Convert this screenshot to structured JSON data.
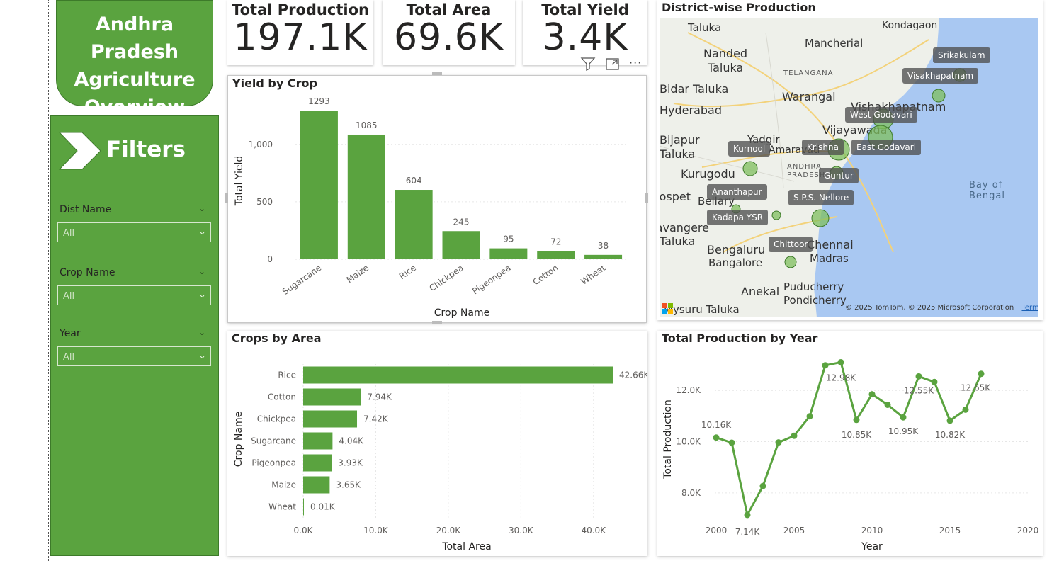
{
  "header": {
    "title": "Andhra Pradesh Agriculture Overview",
    "title_lines": [
      "Andhra Pradesh",
      "Agriculture",
      "Overview"
    ]
  },
  "filters": {
    "title": "Filters",
    "slicers": [
      {
        "label": "Dist Name",
        "value": "All"
      },
      {
        "label": "Crop Name",
        "value": "All"
      },
      {
        "label": "Year",
        "value": "All"
      }
    ]
  },
  "kpis": [
    {
      "label": "Total Production",
      "value": "197.1K"
    },
    {
      "label": "Total Area",
      "value": "69.6K"
    },
    {
      "label": "Total Yield",
      "value": "3.4K"
    }
  ],
  "visual_header_icons": [
    "filter-icon",
    "focus-mode-icon",
    "more-options-icon"
  ],
  "colors": {
    "accent": "#5aa33f",
    "bar": "#5aa33f",
    "sea": "#a9c8f2",
    "land": "#eef0ea"
  },
  "map": {
    "title": "District-wise Production",
    "place_labels": [
      "Taluka",
      "Kondagaon",
      "Mancherial",
      "Nanded",
      "Taluka",
      "Srikakulam",
      "TELANGANA",
      "Bidar Taluka",
      "Warangal",
      "Visakhapatnam",
      "Hyderabad",
      "Vishakhapatnam",
      "Yadgir",
      "Vijayawada",
      "Bijapur",
      "Taluka",
      "Amaravati",
      "ANDHRA",
      "PRADESH",
      "Kurugodu",
      "Bay of Bengal",
      "Bellary",
      "Hospet",
      "Davangere",
      "Taluka",
      "Bengaluru",
      "Bangalore",
      "Chennai",
      "Madras",
      "Anekal",
      "Puducherry",
      "Pondicherry",
      "Mysuru Taluka"
    ],
    "districts": [
      "Srikakulam",
      "Visakhapatnam",
      "West Godavari",
      "Kurnool",
      "Krishna",
      "East Godavari",
      "Guntur",
      "Ananthapur",
      "S.P.S. Nellore",
      "Kadapa YSR",
      "Chittoor"
    ],
    "attribution": "© 2025 TomTom, © 2025 Microsoft Corporation",
    "terms": "Terms",
    "logo": "Microsoft"
  },
  "charts": {
    "yield_by_crop": {
      "title": "Yield by Crop",
      "x_label": "Crop Name",
      "y_label": "Total Yield",
      "y_ticks": [
        "0",
        "500",
        "1,000"
      ],
      "categories": [
        "Sugarcane",
        "Maize",
        "Rice",
        "Chickpea",
        "Pigeonpea",
        "Cotton",
        "Wheat"
      ],
      "values": [
        1293,
        1085,
        604,
        245,
        95,
        72,
        38
      ],
      "data_labels": [
        "1293",
        "1085",
        "604",
        "245",
        "95",
        "72",
        "38"
      ]
    },
    "crops_by_area": {
      "title": "Crops by Area",
      "x_label": "Total Area",
      "y_label": "Crop Name",
      "x_ticks": [
        "0.0K",
        "10.0K",
        "20.0K",
        "30.0K",
        "40.0K"
      ],
      "categories": [
        "Rice",
        "Cotton",
        "Chickpea",
        "Sugarcane",
        "Pigeonpea",
        "Maize",
        "Wheat"
      ],
      "values": [
        42.66,
        7.94,
        7.42,
        4.04,
        3.93,
        3.65,
        0.01
      ],
      "data_labels": [
        "42.66K",
        "7.94K",
        "7.42K",
        "4.04K",
        "3.93K",
        "3.65K",
        "0.01K"
      ]
    },
    "production_by_year": {
      "title": "Total Production by Year",
      "x_label": "Year",
      "y_label": "Total Production",
      "x_ticks": [
        "2000",
        "2005",
        "2010",
        "2015",
        "2020"
      ],
      "y_ticks": [
        "8.0K",
        "10.0K",
        "12.0K"
      ],
      "point_labels": [
        "10.16K",
        "7.14K",
        "12.98K",
        "10.85K",
        "12.55K",
        "10.95K",
        "10.82K",
        "12.65K"
      ]
    }
  },
  "chart_data": [
    {
      "type": "bar",
      "title": "Yield by Crop",
      "xlabel": "Crop Name",
      "ylabel": "Total Yield",
      "categories": [
        "Sugarcane",
        "Maize",
        "Rice",
        "Chickpea",
        "Pigeonpea",
        "Cotton",
        "Wheat"
      ],
      "values": [
        1293,
        1085,
        604,
        245,
        95,
        72,
        38
      ],
      "ylim": [
        0,
        1350
      ]
    },
    {
      "type": "bar",
      "orientation": "horizontal",
      "title": "Crops by Area",
      "xlabel": "Total Area",
      "ylabel": "Crop Name",
      "categories": [
        "Rice",
        "Cotton",
        "Chickpea",
        "Sugarcane",
        "Pigeonpea",
        "Maize",
        "Wheat"
      ],
      "values": [
        42660,
        7940,
        7420,
        4040,
        3930,
        3650,
        10
      ],
      "xlim": [
        0,
        45000
      ]
    },
    {
      "type": "line",
      "title": "Total Production by Year",
      "xlabel": "Year",
      "ylabel": "Total Production",
      "x": [
        2000,
        2001,
        2002,
        2003,
        2004,
        2005,
        2006,
        2007,
        2008,
        2009,
        2010,
        2011,
        2012,
        2013,
        2014,
        2015,
        2016,
        2017
      ],
      "y": [
        10160,
        9960,
        7140,
        8270,
        9970,
        10230,
        10990,
        12980,
        13100,
        10850,
        11850,
        11440,
        10950,
        12550,
        12330,
        10820,
        11250,
        12650
      ],
      "xlim": [
        2000,
        2020
      ],
      "ylim": [
        7000,
        13500
      ]
    }
  ]
}
